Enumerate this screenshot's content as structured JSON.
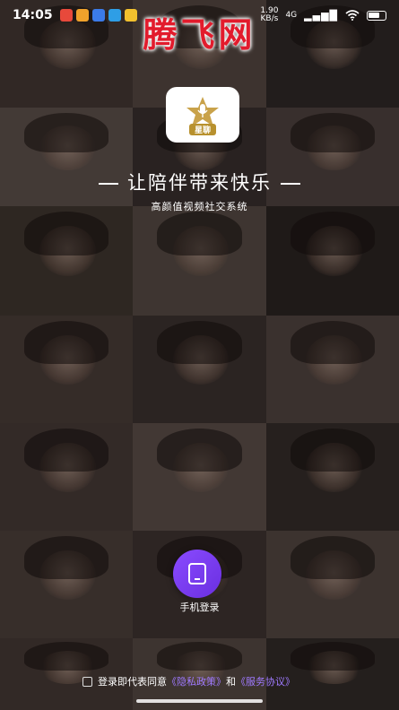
{
  "status_bar": {
    "time": "14:05",
    "net_speed_value": "1.90",
    "net_speed_unit": "KB/s",
    "network_type": "4G",
    "app_icon_colors": [
      "#e8493b",
      "#f0a22b",
      "#3b7be8",
      "#2e9ee6",
      "#f2c12e"
    ]
  },
  "watermark": {
    "text": "腾飞网"
  },
  "logo": {
    "caption": "星聊",
    "gold": "#c9a24a"
  },
  "slogan": {
    "text": "让陪伴带来快乐"
  },
  "subtitle": {
    "text": "高颜值视频社交系统"
  },
  "login": {
    "phone_label": "手机登录",
    "accent": "#7a3cf0"
  },
  "agreement": {
    "prefix": "登录即代表同意",
    "privacy": "《隐私政策》",
    "and": "和",
    "service": "《服务协议》"
  },
  "colors": {
    "tile_tones": [
      "#5a4a44",
      "#6f5e57",
      "#3e3533",
      "#7b6a63",
      "#4b3f3c",
      "#675752",
      "#55473f",
      "#726259",
      "#3a302d",
      "#61504a",
      "#4f423e",
      "#6b5a54",
      "#5d4d48",
      "#786760",
      "#463b37",
      "#64544e",
      "#524440",
      "#6e5d57",
      "#5b4b45",
      "#705f58",
      "#433935"
    ]
  }
}
